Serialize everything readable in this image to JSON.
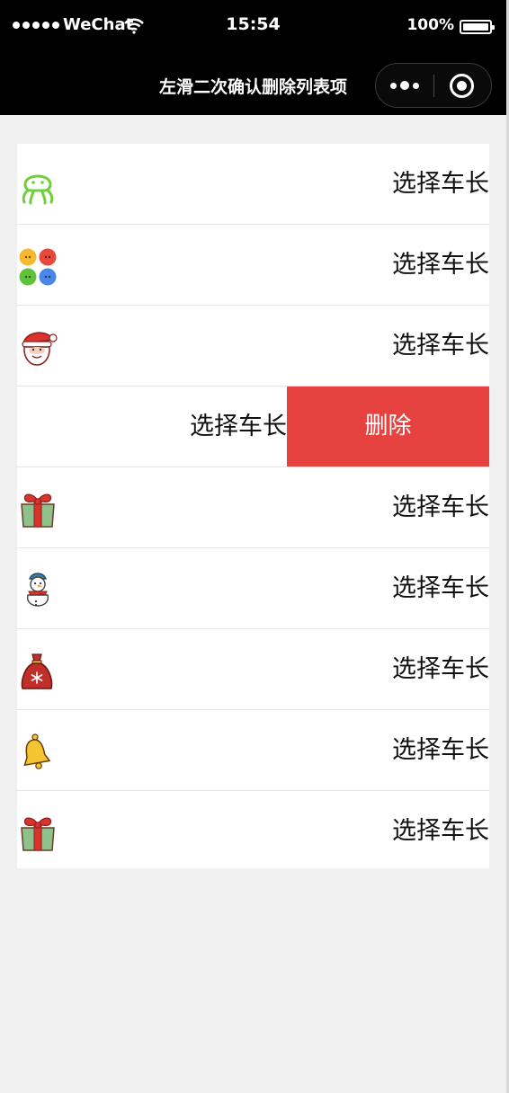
{
  "status_bar": {
    "carrier": "WeChat",
    "time": "15:54",
    "battery": "100%"
  },
  "nav": {
    "title": "左滑二次确认删除列表项"
  },
  "colors": {
    "delete": "#e64340",
    "nav_bg": "#000000",
    "page_bg": "#f0f0f0"
  },
  "list": {
    "items": [
      {
        "icon": "octopus-icon",
        "label": "选择车长"
      },
      {
        "icon": "chat-bubbles-icon",
        "label": "选择车长"
      },
      {
        "icon": "santa-icon",
        "label": "选择车长"
      },
      {
        "icon": "none",
        "label": "选择车长",
        "delete_label": "删除"
      },
      {
        "icon": "gift-icon",
        "label": "选择车长"
      },
      {
        "icon": "snowman-icon",
        "label": "选择车长"
      },
      {
        "icon": "gift-bag-icon",
        "label": "选择车长"
      },
      {
        "icon": "bell-icon",
        "label": "选择车长"
      },
      {
        "icon": "gift-icon",
        "label": "选择车长"
      }
    ]
  }
}
